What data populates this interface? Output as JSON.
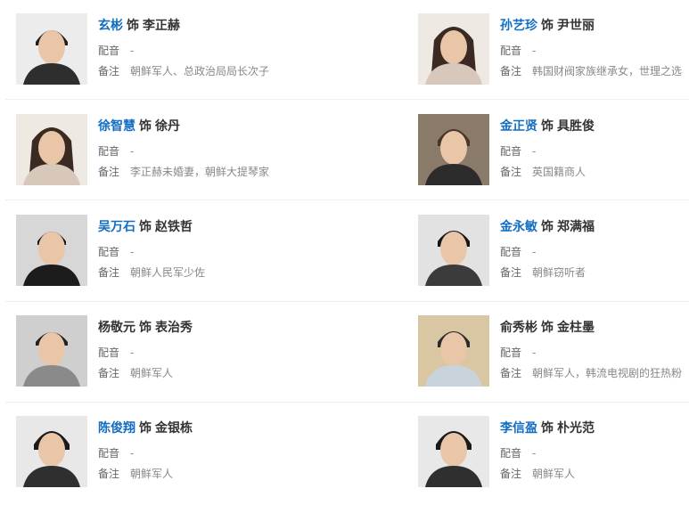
{
  "labels": {
    "separator": "饰",
    "voice": "配音",
    "note": "备注"
  },
  "colors": {
    "link": "#136ec2",
    "text": "#333333",
    "muted": "#888888"
  },
  "cast": [
    {
      "actor": "玄彬",
      "actor_linked": true,
      "role": "李正赫",
      "voice": "-",
      "note": "朝鲜军人、总政治局局长次子",
      "photo": "portrait-man-short-hair"
    },
    {
      "actor": "孙艺珍",
      "actor_linked": true,
      "role": "尹世丽",
      "voice": "-",
      "note": "韩国财阀家族继承女，世理之选",
      "photo": "portrait-woman-long-hair"
    },
    {
      "actor": "徐智慧",
      "actor_linked": true,
      "role": "徐丹",
      "voice": "-",
      "note": "李正赫未婚妻，朝鲜大提琴家",
      "photo": "portrait-woman-long-hair"
    },
    {
      "actor": "金正贤",
      "actor_linked": true,
      "role": "具胜俊",
      "voice": "-",
      "note": "英国籍商人",
      "photo": "portrait-man-coat"
    },
    {
      "actor": "吴万石",
      "actor_linked": true,
      "role": "赵铁哲",
      "voice": "-",
      "note": "朝鲜人民军少佐",
      "photo": "portrait-man-suit-waving"
    },
    {
      "actor": "金永敏",
      "actor_linked": true,
      "role": "郑满福",
      "voice": "-",
      "note": "朝鲜窃听者",
      "photo": "portrait-man-jacket"
    },
    {
      "actor": "杨敬元",
      "actor_linked": false,
      "role": "表治秀",
      "voice": "-",
      "note": "朝鲜军人",
      "photo": "portrait-man-smiling"
    },
    {
      "actor": "俞秀彬",
      "actor_linked": false,
      "role": "金柱墨",
      "voice": "-",
      "note": "朝鲜军人，韩流电视剧的狂热粉",
      "photo": "portrait-man-sweater"
    },
    {
      "actor": "陈俊翔",
      "actor_linked": true,
      "role": "金银栋",
      "voice": "-",
      "note": "朝鲜军人",
      "photo": "portrait-young-man"
    },
    {
      "actor": "李信盈",
      "actor_linked": true,
      "role": "朴光范",
      "voice": "-",
      "note": "朝鲜军人",
      "photo": "portrait-young-man"
    }
  ]
}
